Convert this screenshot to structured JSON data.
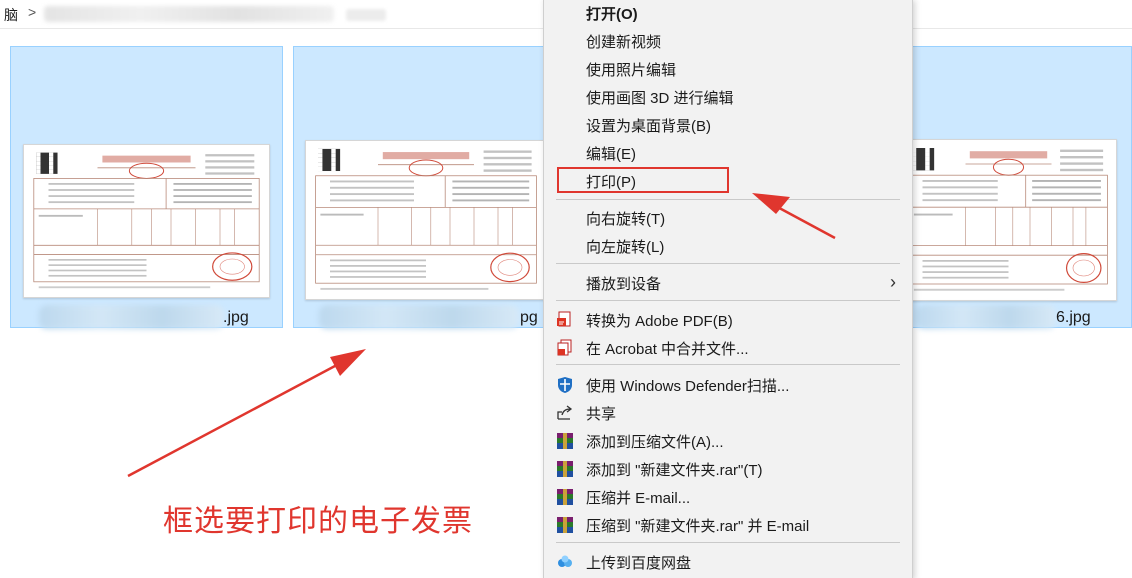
{
  "breadcrumb": {
    "root": "脑",
    "separator": ">"
  },
  "files": [
    {
      "suffix": ".jpg"
    },
    {
      "suffix": "pg"
    },
    {
      "suffix": "6.jpg"
    }
  ],
  "context_menu": {
    "items": [
      {
        "label": "打开(O)",
        "bold": true
      },
      {
        "label": "创建新视频"
      },
      {
        "label": "使用照片编辑"
      },
      {
        "label": "使用画图 3D 进行编辑"
      },
      {
        "label": "设置为桌面背景(B)"
      },
      {
        "label": "编辑(E)"
      },
      {
        "label": "打印(P)",
        "highlighted": true
      },
      {
        "label": "向右旋转(T)"
      },
      {
        "label": "向左旋转(L)"
      },
      {
        "label": "播放到设备",
        "submenu": true
      },
      {
        "label": "转换为 Adobe PDF(B)",
        "icon": "adobe-pdf-icon"
      },
      {
        "label": "在 Acrobat 中合并文件...",
        "icon": "acrobat-combine-icon"
      },
      {
        "label": "使用 Windows Defender扫描...",
        "icon": "windows-defender-shield-icon"
      },
      {
        "label": "共享",
        "icon": "share-icon"
      },
      {
        "label": "添加到压缩文件(A)...",
        "icon": "winrar-icon"
      },
      {
        "label": "添加到 \"新建文件夹.rar\"(T)",
        "icon": "winrar-icon"
      },
      {
        "label": "压缩并 E-mail...",
        "icon": "winrar-icon"
      },
      {
        "label": "压缩到 \"新建文件夹.rar\" 并 E-mail",
        "icon": "winrar-icon"
      },
      {
        "label": "上传到百度网盘",
        "icon": "baidu-netdisk-icon"
      }
    ]
  },
  "annotation": {
    "text": "框选要打印的电子发票",
    "color": "#e0362e"
  },
  "colors": {
    "selection_fill": "#cce8ff",
    "selection_border": "#99d1ff",
    "menu_background": "#f2f2f2",
    "highlight_red": "#e0362e"
  }
}
